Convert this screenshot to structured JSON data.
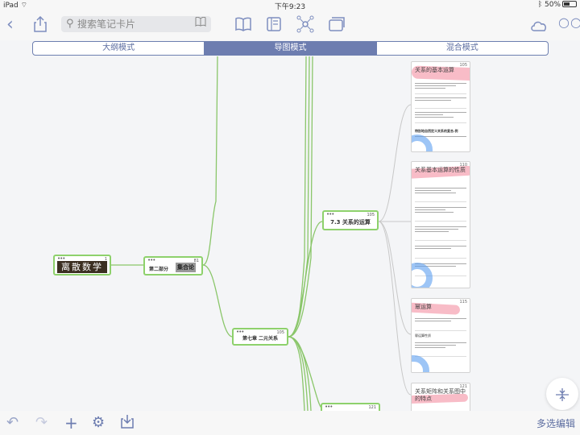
{
  "status": {
    "device": "iPad",
    "time": "下午9:23",
    "battery": "50%"
  },
  "toolbar": {
    "back_icon": "chevron-left-icon",
    "share_icon": "share-icon",
    "search_placeholder": "搜索笔记卡片",
    "book_icon": "book-icon",
    "view_icons": [
      "open-book-icon",
      "outline-icon",
      "mindmap-icon",
      "cards-icon"
    ],
    "cloud_icon": "cloud-sync-icon",
    "more_icon": "more-icon"
  },
  "segments": {
    "items": [
      "大纲模式",
      "导图模式",
      "混合模式"
    ],
    "active": 1
  },
  "mindmap": {
    "nodes": [
      {
        "id": "root",
        "label": "离散数学",
        "badge": "1"
      },
      {
        "id": "part2",
        "label": "第二部分",
        "highlight": "集合论",
        "badge": "81"
      },
      {
        "id": "ch7",
        "label": "第七章  二元关系",
        "badge": "105"
      },
      {
        "id": "s73",
        "label": "7.3  关系的运算",
        "badge": "105"
      },
      {
        "id": "next",
        "label": "",
        "badge": "121"
      }
    ],
    "cards": [
      {
        "title": "关系的基本运算",
        "badge": "105",
        "footer": "特别地自然定义关系的复合.例"
      },
      {
        "title": "关系基本运算的性质",
        "badge": "110",
        "footer": ""
      },
      {
        "title": "幂运算",
        "badge": "115",
        "footer": "幂运算性质"
      },
      {
        "title": "关系矩阵和关系图中的特点",
        "badge": "121",
        "footer": ""
      }
    ]
  },
  "bottom": {
    "icons": [
      "undo-icon",
      "redo-icon",
      "add-icon",
      "settings-icon",
      "export-icon"
    ],
    "multi_select": "多选编辑"
  },
  "fab_icon": "focus-icon",
  "colors": {
    "accent": "#6d7db0",
    "node_border": "#8ed16c",
    "line": "#8ac66a"
  }
}
